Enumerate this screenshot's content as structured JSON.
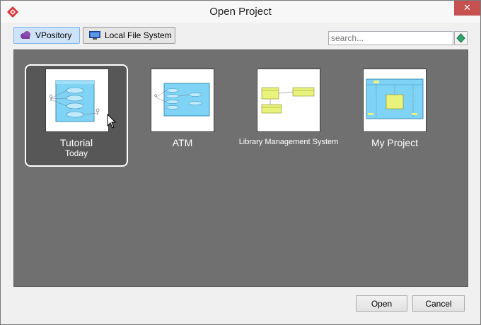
{
  "window": {
    "title": "Open Project",
    "close_label": "✕"
  },
  "source_tabs": [
    {
      "label": "VPository",
      "icon": "cloud-icon",
      "selected": true
    },
    {
      "label": "Local File System",
      "icon": "monitor-icon",
      "selected": false
    }
  ],
  "search": {
    "placeholder": "search..."
  },
  "projects": [
    {
      "name": "Tutorial",
      "date": "Today",
      "selected": true
    },
    {
      "name": "ATM",
      "date": "",
      "selected": false
    },
    {
      "name": "Library Management System",
      "date": "",
      "selected": false
    },
    {
      "name": "My Project",
      "date": "",
      "selected": false
    }
  ],
  "buttons": {
    "open": "Open",
    "cancel": "Cancel"
  },
  "colors": {
    "panel_bg": "#707070",
    "selected_tab": "#cfe3f8",
    "close_red": "#c75050",
    "diagram_blue": "#7fd3f5",
    "diagram_yellow": "#e9f27a"
  }
}
